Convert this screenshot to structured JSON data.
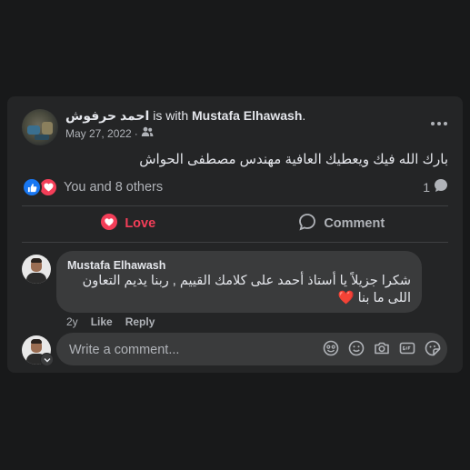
{
  "post": {
    "author": "احمد حرفوش",
    "with_text": "is with",
    "tagged": "Mustafa Elhawash",
    "period": ".",
    "date": "May 27, 2022",
    "separator": "·",
    "audience_icon": "friends-icon",
    "body": "بارك الله فيك ويعطيك العافية مهندس مصطفى الحواش",
    "reactions_text": "You and 8 others",
    "comment_count": "1"
  },
  "actions": {
    "love_label": "Love",
    "comment_label": "Comment"
  },
  "comment": {
    "author": "Mustafa Elhawash",
    "text": "شكرا جزيلاً يا أستاذ أحمد على كلامك القييم , ربنا يديم التعاون اللى ما بنا",
    "emoji": "❤️",
    "age": "2y",
    "like_label": "Like",
    "reply_label": "Reply"
  },
  "composer": {
    "placeholder": "Write a comment...",
    "icons": [
      "emoji-icon",
      "smiley-icon",
      "camera-icon",
      "gif-icon",
      "sticker-icon"
    ]
  },
  "colors": {
    "background": "#18191a",
    "card": "#242526",
    "bubble": "#3a3b3c",
    "love": "#f33e58",
    "like": "#1877f2",
    "secondary_text": "#b0b3b8"
  }
}
